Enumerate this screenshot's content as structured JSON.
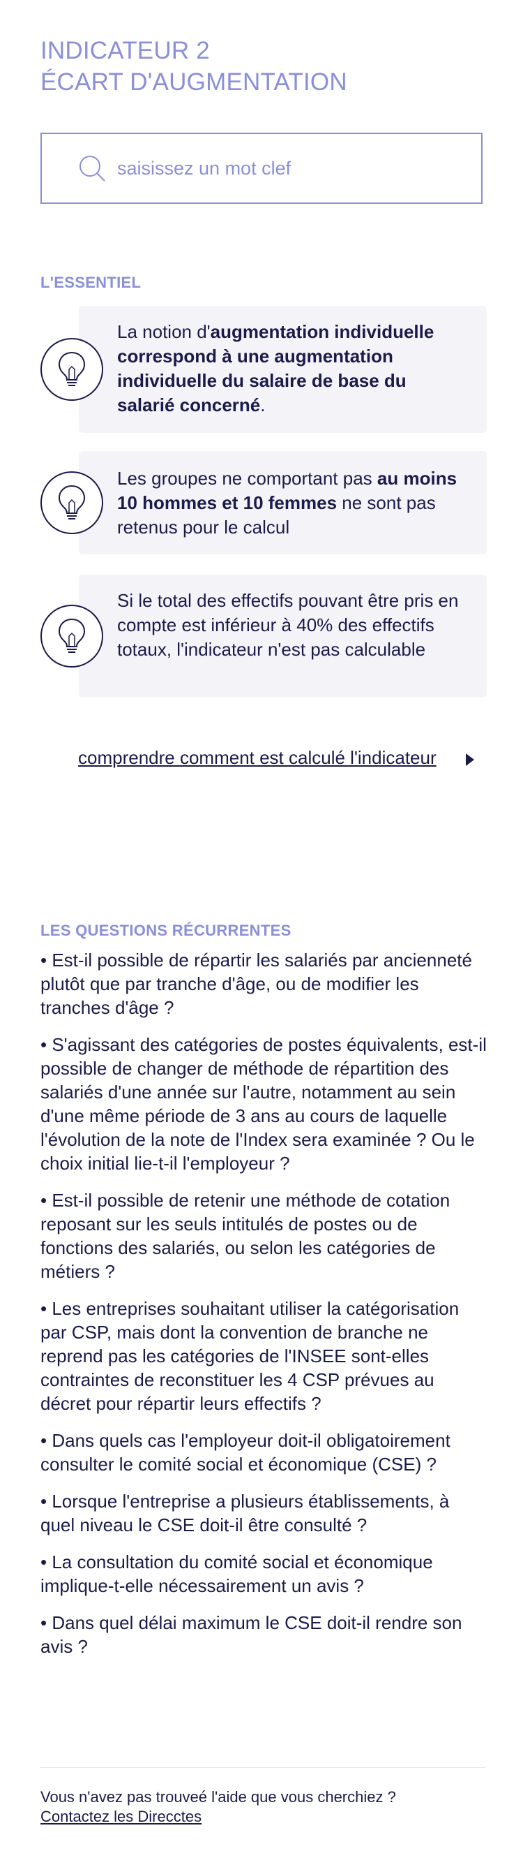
{
  "header": {
    "title_line1": "INDICATEUR 2",
    "title_line2": "ÉCART D'AUGMENTATION"
  },
  "search": {
    "placeholder": "saisissez un mot clef",
    "value": ""
  },
  "essentiel": {
    "label": "L'ESSENTIEL",
    "tips": [
      {
        "icon": "lightbulb-icon",
        "parts": [
          {
            "text": "La notion d'",
            "bold": false
          },
          {
            "text": "augmentation individuelle correspond à une augmentation individuelle du salaire de base du salarié concerné",
            "bold": true
          },
          {
            "text": ".",
            "bold": false
          }
        ]
      },
      {
        "icon": "lightbulb-icon",
        "parts": [
          {
            "text": "Les groupes ne comportant pas ",
            "bold": false
          },
          {
            "text": "au moins 10 hommes et 10 femmes",
            "bold": true
          },
          {
            "text": " ne sont pas retenus pour le calcul",
            "bold": false
          }
        ]
      },
      {
        "icon": "lightbulb-icon",
        "parts": [
          {
            "text": "Si le total des effectifs pouvant être pris en compte est inférieur à 40% des effectifs totaux, l'indicateur n'est pas calculable",
            "bold": false
          }
        ]
      }
    ],
    "calc_link": "comprendre comment est calculé l'indicateur",
    "calc_link_icon": "triangle-right-icon"
  },
  "faq": {
    "label": "LES QUESTIONS RÉCURRENTES",
    "items": [
      "• Est-il possible de répartir les salariés par ancienneté plutôt que par tranche d'âge, ou de modifier les tranches d'âge ?",
      "• S'agissant des catégories de postes équivalents, est-il possible de changer de méthode de répartition des salariés d'une année sur l'autre, notamment au sein d'une même période de 3 ans au cours de laquelle l'évolution de la note de l'Index sera examinée ? Ou le choix initial lie-t-il l'employeur ?",
      "• Est-il possible de retenir une méthode de cotation reposant sur les seuls intitulés de postes ou de fonctions des salariés, ou selon les catégories de métiers ?",
      "• Les entreprises souhaitant utiliser la catégorisation par CSP, mais dont la convention de branche ne reprend pas les catégories de l'INSEE sont-elles contraintes de reconstituer les 4 CSP prévues au décret pour répartir leurs effectifs ?",
      "• Dans quels cas l'employeur doit-il obligatoirement consulter le comité social et économique (CSE) ?",
      "• Lorsque l'entreprise a plusieurs établissements, à quel niveau le CSE doit-il être consulté ?",
      "• La consultation du comité social et économique implique-t-elle nécessairement un avis ?",
      "• Dans quel délai maximum le CSE doit-il rendre son avis ?"
    ]
  },
  "footer": {
    "text": "Vous n'avez pas trouveé l'aide que vous cherchiez ?",
    "link": "Contactez les Direcctes"
  },
  "colors": {
    "accent": "#8a8fd8",
    "text": "#1b1b4a",
    "tip_background": "#f4f4f8"
  }
}
